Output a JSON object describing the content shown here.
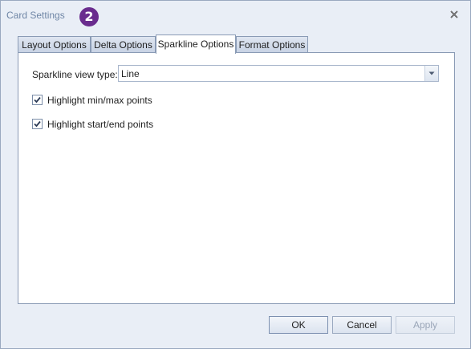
{
  "window": {
    "title": "Card Settings",
    "step_badge": "2"
  },
  "tabs": [
    {
      "label": "Layout Options",
      "active": false
    },
    {
      "label": "Delta Options",
      "active": false
    },
    {
      "label": "Sparkline Options",
      "active": true
    },
    {
      "label": "Format Options",
      "active": false
    }
  ],
  "sparkline": {
    "view_type_label": "Sparkline view type:",
    "view_type_value": "Line",
    "highlight_minmax_label": "Highlight min/max points",
    "highlight_minmax_checked": true,
    "highlight_startend_label": "Highlight start/end points",
    "highlight_startend_checked": true
  },
  "buttons": {
    "ok": "OK",
    "cancel": "Cancel",
    "apply": "Apply"
  },
  "icons": {
    "close": "close-icon",
    "dropdown": "chevron-down-icon",
    "check": "checkmark-icon"
  },
  "colors": {
    "window_bg": "#e9eef6",
    "title_text": "#6f86a6",
    "badge_bg": "#6a2c8e",
    "border": "#8a9bb5"
  }
}
